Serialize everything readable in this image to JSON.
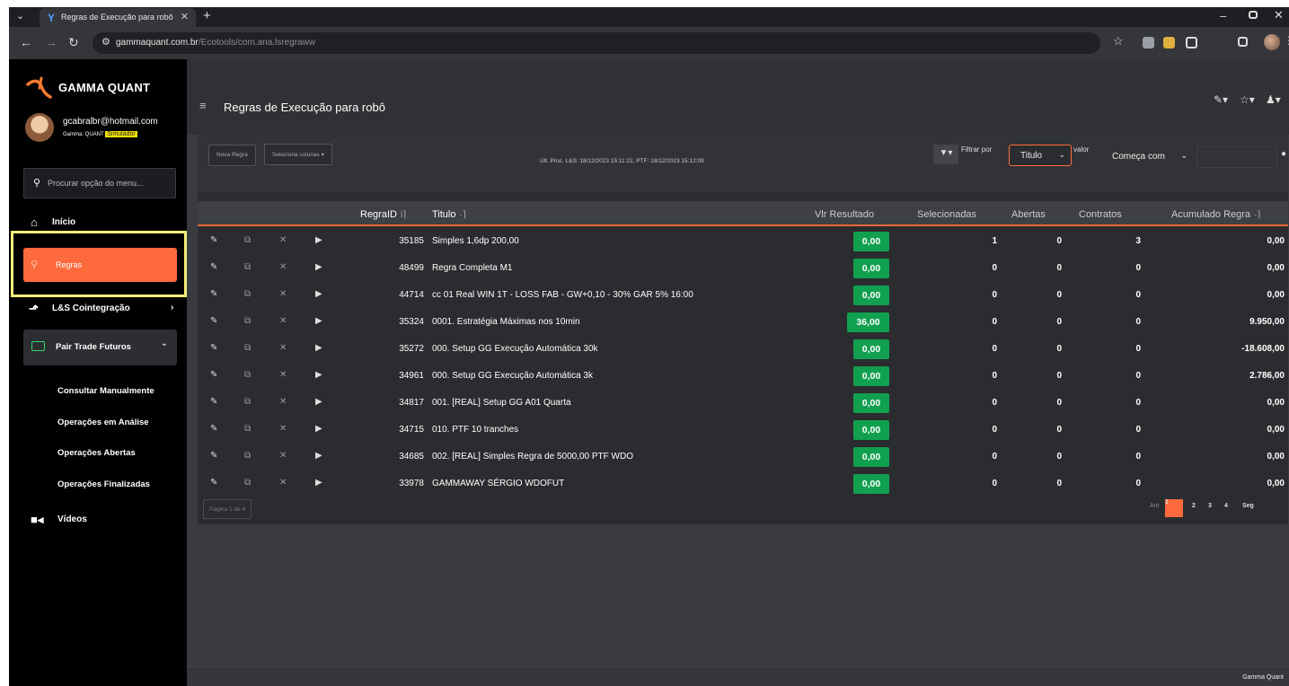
{
  "browser": {
    "tab_title": "Regras de Execução para robô",
    "tab_close": "✕",
    "new_tab": "+",
    "url_host": "gammaquant.com.br",
    "url_path": "/Ecotools/com.ana.lsregraww"
  },
  "sidebar": {
    "brand": "GAMMA QUANT",
    "user_email": "gcabralbr@hotmail.com",
    "user_sub": "Gamma: QUANT",
    "user_badge": "Simulador",
    "search_placeholder": "Procurar opção do menu...",
    "items": {
      "inicio": "Início",
      "regras": "Regras",
      "lbs": "L&S Cointegração",
      "pair": "Pair Trade Futuros",
      "consultar": "Consultar Manualmente",
      "analise": "Operações em Análise",
      "abertas": "Operações Abertas",
      "finalizadas": "Operações Finalizadas",
      "videos": "Vídeos"
    }
  },
  "header": {
    "title": "Regras de Execução para robô"
  },
  "toolbar": {
    "new_rule": "Nova Regra",
    "select_columns": "Seleciona colunas ▾",
    "proc_info": "Últ. Proc. L&S: 18/12/2023 15:11:22, PTF: 18/12/2023 15:12:09",
    "filter_label": "Filtrar por",
    "filter_field": "Titulo",
    "valor_label": "valor",
    "filter_op": "Começa com"
  },
  "table": {
    "columns": {
      "regraid": "RegraID",
      "titulo": "Titulo",
      "resultado": "Vlr Resultado",
      "selecionadas": "Selecionadas",
      "abertas": "Abertas",
      "contratos": "Contratos",
      "acumulado": "Acumulado Regra"
    },
    "rows": [
      {
        "id": "35185",
        "titulo": "Simples 1,6dp 200,00",
        "resultado": "0,00",
        "sel": "1",
        "abertas": "0",
        "contratos": "3",
        "acumulado": "0,00"
      },
      {
        "id": "48499",
        "titulo": "Regra Completa M1",
        "resultado": "0,00",
        "sel": "0",
        "abertas": "0",
        "contratos": "0",
        "acumulado": "0,00"
      },
      {
        "id": "44714",
        "titulo": "cc 01 Real WIN 1T - LOSS FAB - GW+0,10 - 30% GAR 5% 16:00",
        "resultado": "0,00",
        "sel": "0",
        "abertas": "0",
        "contratos": "0",
        "acumulado": "0,00"
      },
      {
        "id": "35324",
        "titulo": "0001. Estratégia Máximas nos 10min",
        "resultado": "36,00",
        "sel": "0",
        "abertas": "0",
        "contratos": "0",
        "acumulado": "9.950,00"
      },
      {
        "id": "35272",
        "titulo": "000. Setup GG Execução Automática 30k",
        "resultado": "0,00",
        "sel": "0",
        "abertas": "0",
        "contratos": "0",
        "acumulado": "-18.608,00"
      },
      {
        "id": "34961",
        "titulo": "000. Setup GG Execução Automática 3k",
        "resultado": "0,00",
        "sel": "0",
        "abertas": "0",
        "contratos": "0",
        "acumulado": "2.786,00"
      },
      {
        "id": "34817",
        "titulo": "001. [REAL] Setup GG A01 Quarta",
        "resultado": "0,00",
        "sel": "0",
        "abertas": "0",
        "contratos": "0",
        "acumulado": "0,00"
      },
      {
        "id": "34715",
        "titulo": "010. PTF 10 tranches",
        "resultado": "0,00",
        "sel": "0",
        "abertas": "0",
        "contratos": "0",
        "acumulado": "0,00"
      },
      {
        "id": "34685",
        "titulo": "002. [REAL] Simples Regra de 5000,00 PTF WDO",
        "resultado": "0,00",
        "sel": "0",
        "abertas": "0",
        "contratos": "0",
        "acumulado": "0,00"
      },
      {
        "id": "33978",
        "titulo": "GAMMAWAY SÉRGIO WDOFUT",
        "resultado": "0,00",
        "sel": "0",
        "abertas": "0",
        "contratos": "0",
        "acumulado": "0,00"
      }
    ]
  },
  "pagination": {
    "info": "Página 1 de 4",
    "prev": "Ant",
    "pages": [
      "1",
      "2",
      "3",
      "4"
    ],
    "next": "Seg"
  },
  "footer": {
    "text": "Gamma Quant"
  },
  "colors": {
    "accent": "#ff6a3d",
    "result_green": "#11a04f",
    "highlight_box": "#f4ef7a",
    "simulator_badge": "#f3e400"
  }
}
